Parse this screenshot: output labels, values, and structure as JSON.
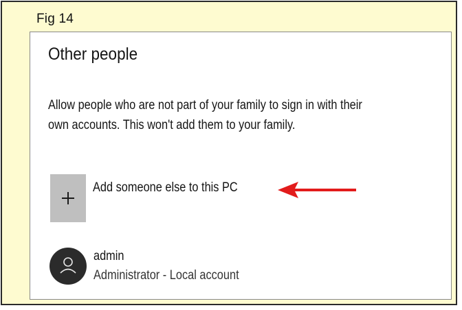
{
  "figure": {
    "label": "Fig 14"
  },
  "section": {
    "title": "Other people",
    "description_lines": [
      "Allow people who are not part of your family to sign in with their",
      "own accounts. This won't add them to your family."
    ]
  },
  "add_person": {
    "label": "Add someone else to this PC",
    "icon": "plus-icon"
  },
  "annotation": {
    "icon": "red-arrow",
    "color": "#e21b1b"
  },
  "accounts": [
    {
      "name": "admin",
      "role": "Administrator - Local account",
      "icon": "user-avatar-icon"
    }
  ]
}
